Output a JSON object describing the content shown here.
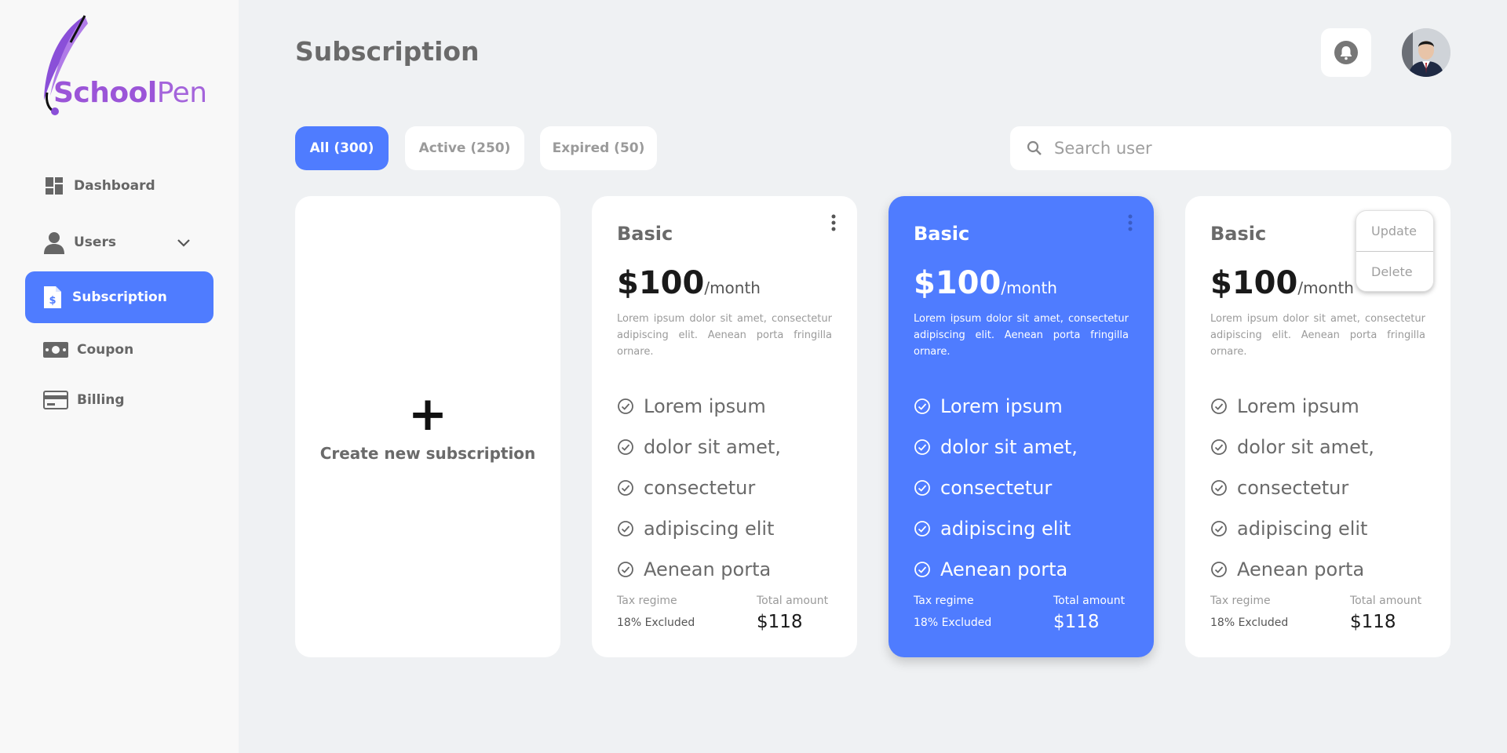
{
  "brand": {
    "name_part1": "School",
    "name_part2": "Pen",
    "accent": "#9b55d8"
  },
  "colors": {
    "primary": "#4f7cff",
    "background": "#eff1f3",
    "sidebar": "#f8f8f8"
  },
  "sidebar": {
    "items": [
      {
        "label": "Dashboard",
        "icon": "dashboard-icon",
        "active": false
      },
      {
        "label": "Users",
        "icon": "user-icon",
        "active": false,
        "expandable": true
      },
      {
        "label": "Subscription",
        "icon": "document-dollar-icon",
        "active": true
      },
      {
        "label": "Coupon",
        "icon": "cash-icon",
        "active": false
      },
      {
        "label": "Billing",
        "icon": "credit-card-icon",
        "active": false
      }
    ]
  },
  "header": {
    "title": "Subscription",
    "bell_icon": "bell-icon",
    "avatar_icon": "user-avatar"
  },
  "filters": [
    {
      "label": "All (300)",
      "active": true
    },
    {
      "label": "Active  (250)",
      "active": false
    },
    {
      "label": "Expired (50)",
      "active": false
    }
  ],
  "search": {
    "placeholder": "Search user",
    "value": ""
  },
  "create_card": {
    "plus": "+",
    "label": "Create new subscription"
  },
  "plans": [
    {
      "name": "Basic",
      "price": "$100",
      "period": "/month",
      "description": "Lorem ipsum dolor sit amet, consectetur adipiscing elit. Aenean porta fringilla ornare.",
      "features": [
        "Lorem ipsum",
        "dolor sit amet,",
        "consectetur",
        "adipiscing elit",
        "Aenean porta"
      ],
      "tax_label": "Tax regime",
      "tax_value": "18% Excluded",
      "total_label": "Total amount",
      "total_value": "$118",
      "highlighted": false
    },
    {
      "name": "Basic",
      "price": "$100",
      "period": "/month",
      "description": "Lorem ipsum dolor sit amet, consectetur adipiscing elit. Aenean porta fringilla ornare.",
      "features": [
        "Lorem ipsum",
        "dolor sit amet,",
        "consectetur",
        "adipiscing elit",
        "Aenean porta"
      ],
      "tax_label": "Tax regime",
      "tax_value": "18% Excluded",
      "total_label": "Total amount",
      "total_value": "$118",
      "highlighted": true
    },
    {
      "name": "Basic",
      "price": "$100",
      "period": "/month",
      "description": "Lorem ipsum dolor sit amet, consectetur adipiscing elit. Aenean porta fringilla ornare.",
      "features": [
        "Lorem ipsum",
        "dolor sit amet,",
        "consectetur",
        "adipiscing elit",
        "Aenean porta"
      ],
      "tax_label": "Tax regime",
      "tax_value": "18% Excluded",
      "total_label": "Total amount",
      "total_value": "$118",
      "highlighted": false
    }
  ],
  "context_menu": {
    "items": [
      "Update",
      "Delete"
    ]
  }
}
